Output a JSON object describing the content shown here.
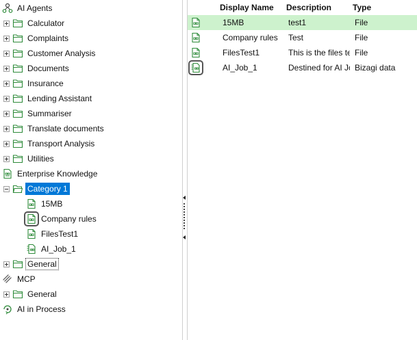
{
  "tree": {
    "ai_agents": "AI Agents",
    "agents": [
      "Calculator",
      "Complaints",
      "Customer Analysis",
      "Documents",
      "Insurance",
      "Lending Assistant",
      "Summariser",
      "Translate documents",
      "Transport Analysis",
      "Utilities"
    ],
    "enterprise_knowledge": "Enterprise Knowledge",
    "category1": "Category 1",
    "category1_items": [
      "15MB",
      "Company rules",
      "FilesTest1",
      "AI_Job_1"
    ],
    "general1": "General",
    "mcp": "MCP",
    "general2": "General",
    "ai_in_process": "AI in Process"
  },
  "list": {
    "headers": {
      "name": "Display Name",
      "description": "Description",
      "type": "Type"
    },
    "rows": [
      {
        "name": "15MB",
        "description": "test1",
        "type": "File",
        "icon": "file-icon"
      },
      {
        "name": "Company rules",
        "description": "Test",
        "type": "File",
        "icon": "file-icon"
      },
      {
        "name": "FilesTest1",
        "description": "This is the files te",
        "type": "File",
        "icon": "file-icon"
      },
      {
        "name": "AI_Job_1",
        "description": "Destined for AI Jo",
        "type": "Bizagi data",
        "icon": "ai-job-file-icon"
      }
    ]
  },
  "colors": {
    "selection": "#0078d7",
    "row_highlight": "#cdf2cd",
    "icon_green": "#2e8b3a"
  }
}
